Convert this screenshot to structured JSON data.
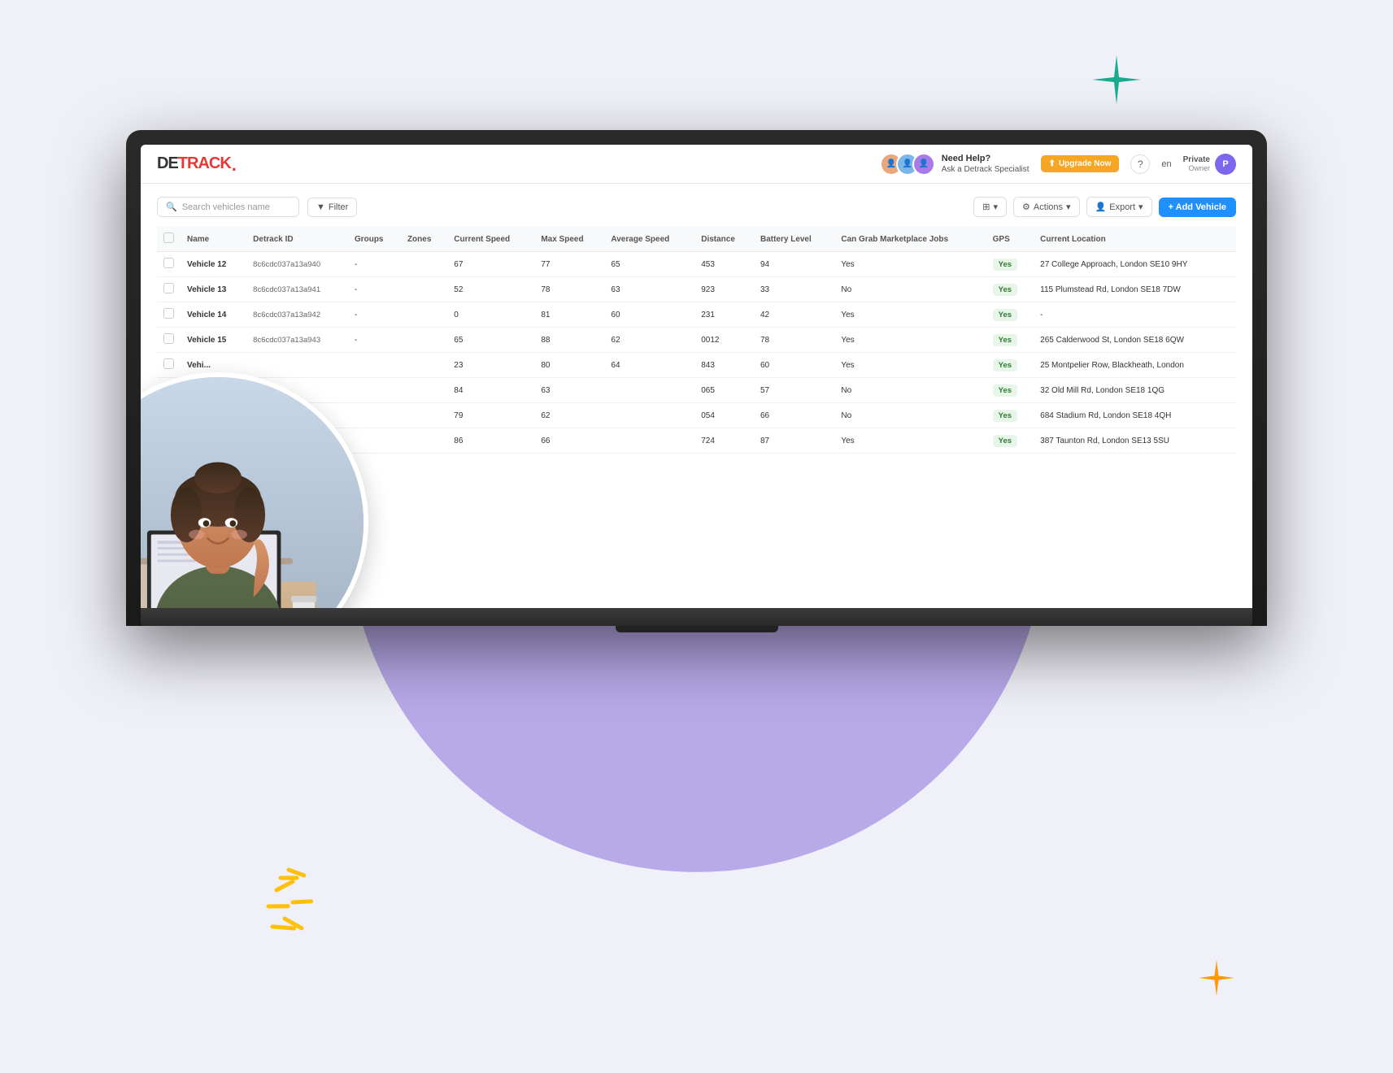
{
  "bg": {
    "circle_color": "#b8a9e8"
  },
  "header": {
    "logo_de": "DE",
    "logo_track": "TRACK",
    "help_title": "Need Help?",
    "help_subtitle": "Ask a Detrack Specialist",
    "upgrade_label": "Upgrade Now",
    "lang": "en",
    "private_label": "Private",
    "private_sub": "Owner",
    "private_initial": "P"
  },
  "toolbar": {
    "search_placeholder": "Search vehicles name",
    "filter_label": "Filter",
    "columns_label": "⊞",
    "actions_label": "Actions",
    "export_label": "Export",
    "add_vehicle_label": "+ Add Vehicle"
  },
  "table": {
    "columns": [
      "",
      "Name",
      "Detrack ID",
      "Groups",
      "Zones",
      "Current Speed",
      "Max Speed",
      "Average Speed",
      "Distance",
      "Battery Level",
      "Can Grab Marketplace Jobs",
      "GPS",
      "Current Location"
    ],
    "rows": [
      {
        "name": "Vehicle 12",
        "detrack_id": "8c6cdc037a13a940",
        "groups": "-",
        "zones": "",
        "current_speed": "67",
        "max_speed": "77",
        "avg_speed": "65",
        "distance": "453",
        "battery": "94",
        "grab": "Yes",
        "gps": "Yes",
        "location": "27 College Approach, London SE10 9HY"
      },
      {
        "name": "Vehicle 13",
        "detrack_id": "8c6cdc037a13a941",
        "groups": "-",
        "zones": "",
        "current_speed": "52",
        "max_speed": "78",
        "avg_speed": "63",
        "distance": "923",
        "battery": "33",
        "grab": "No",
        "gps": "Yes",
        "location": "115 Plumstead Rd, London SE18 7DW"
      },
      {
        "name": "Vehicle 14",
        "detrack_id": "8c6cdc037a13a942",
        "groups": "-",
        "zones": "",
        "current_speed": "0",
        "max_speed": "81",
        "avg_speed": "60",
        "distance": "231",
        "battery": "42",
        "grab": "Yes",
        "gps": "Yes",
        "location": "-"
      },
      {
        "name": "Vehicle 15",
        "detrack_id": "8c6cdc037a13a943",
        "groups": "-",
        "zones": "",
        "current_speed": "65",
        "max_speed": "88",
        "avg_speed": "62",
        "distance": "0012",
        "battery": "78",
        "grab": "Yes",
        "gps": "Yes",
        "location": "265 Calderwood St, London SE18 6QW"
      },
      {
        "name": "Vehi...",
        "detrack_id": "",
        "groups": "",
        "zones": "",
        "current_speed": "23",
        "max_speed": "80",
        "avg_speed": "64",
        "distance": "843",
        "battery": "60",
        "grab": "Yes",
        "gps": "Yes",
        "location": "25 Montpelier Row, Blackheath, London"
      },
      {
        "name": "",
        "detrack_id": "",
        "groups": "",
        "zones": "",
        "current_speed": "84",
        "max_speed": "63",
        "avg_speed": "",
        "distance": "065",
        "battery": "57",
        "grab": "No",
        "gps": "Yes",
        "location": "32 Old Mill Rd, London SE18 1QG"
      },
      {
        "name": "",
        "detrack_id": "",
        "groups": "",
        "zones": "",
        "current_speed": "79",
        "max_speed": "62",
        "avg_speed": "",
        "distance": "054",
        "battery": "66",
        "grab": "No",
        "gps": "Yes",
        "location": "684 Stadium Rd, London SE18 4QH"
      },
      {
        "name": "",
        "detrack_id": "",
        "groups": "",
        "zones": "",
        "current_speed": "86",
        "max_speed": "66",
        "avg_speed": "",
        "distance": "724",
        "battery": "87",
        "grab": "Yes",
        "gps": "Yes",
        "location": "387 Taunton Rd, London SE13 5SU"
      }
    ]
  }
}
